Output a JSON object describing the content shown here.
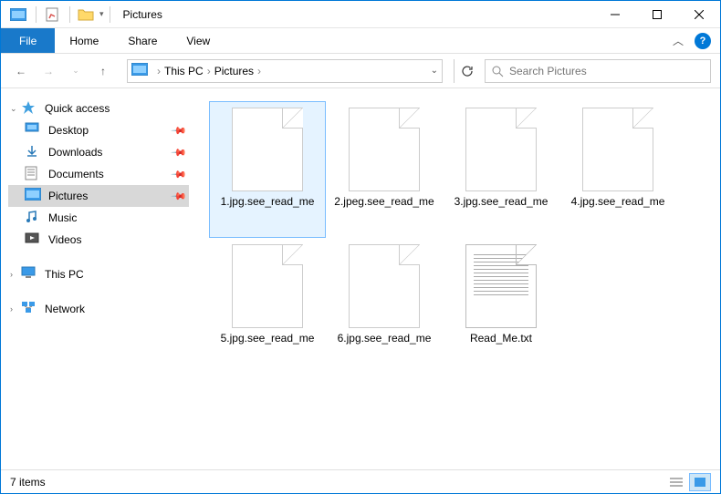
{
  "window": {
    "title": "Pictures"
  },
  "ribbon": {
    "file": "File",
    "tabs": [
      "Home",
      "Share",
      "View"
    ]
  },
  "breadcrumb": {
    "items": [
      "This PC",
      "Pictures"
    ]
  },
  "search": {
    "placeholder": "Search Pictures"
  },
  "sidebar": {
    "quick_access": {
      "label": "Quick access",
      "items": [
        {
          "label": "Desktop",
          "pinned": true,
          "icon": "desktop"
        },
        {
          "label": "Downloads",
          "pinned": true,
          "icon": "downloads"
        },
        {
          "label": "Documents",
          "pinned": true,
          "icon": "documents"
        },
        {
          "label": "Pictures",
          "pinned": true,
          "icon": "pictures",
          "selected": true
        },
        {
          "label": "Music",
          "pinned": false,
          "icon": "music"
        },
        {
          "label": "Videos",
          "pinned": false,
          "icon": "videos"
        }
      ]
    },
    "this_pc": {
      "label": "This PC"
    },
    "network": {
      "label": "Network"
    }
  },
  "files": [
    {
      "name": "1.jpg.see_read_me",
      "type": "blank",
      "selected": true
    },
    {
      "name": "2.jpeg.see_read_me",
      "type": "blank"
    },
    {
      "name": "3.jpg.see_read_me",
      "type": "blank"
    },
    {
      "name": "4.jpg.see_read_me",
      "type": "blank"
    },
    {
      "name": "5.jpg.see_read_me",
      "type": "blank"
    },
    {
      "name": "6.jpg.see_read_me",
      "type": "blank"
    },
    {
      "name": "Read_Me.txt",
      "type": "text"
    }
  ],
  "status": {
    "count_label": "7 items"
  },
  "colors": {
    "accent": "#0078d7",
    "file_tab": "#1979ca",
    "selection": "#e5f3ff",
    "selection_border": "#7abdff"
  }
}
